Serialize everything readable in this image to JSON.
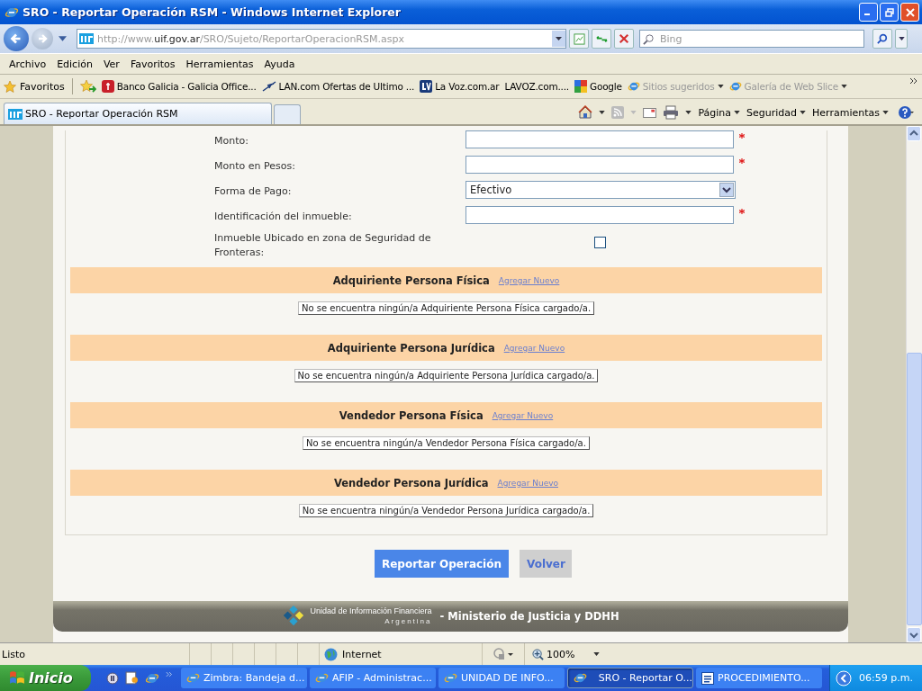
{
  "window": {
    "title": "SRO - Reportar Operación RSM - Windows Internet Explorer"
  },
  "address_bar": {
    "url_prefix": "http://www.",
    "url_domain": "uif.gov.ar",
    "url_path": "/SRO/Sujeto/ReportarOperacionRSM.aspx"
  },
  "search": {
    "placeholder": "Bing"
  },
  "menu": [
    "Archivo",
    "Edición",
    "Ver",
    "Favoritos",
    "Herramientas",
    "Ayuda"
  ],
  "favorites": {
    "label": "Favoritos",
    "items": [
      {
        "kind": "galicia",
        "label": "Banco Galicia - Galicia Office...",
        "dimmed": false,
        "dropdown": false
      },
      {
        "kind": "lan",
        "label": "LAN.com Ofertas de Ultimo ...",
        "dimmed": false,
        "dropdown": false
      },
      {
        "kind": "lavoz",
        "label": "La Voz.com.ar",
        "dimmed": false,
        "dropdown": false
      },
      {
        "kind": "plain",
        "label": "LAVOZ.com....",
        "dimmed": false,
        "dropdown": false
      },
      {
        "kind": "google",
        "label": "Google",
        "dimmed": false,
        "dropdown": false
      },
      {
        "kind": "ie",
        "label": "Sitios sugeridos",
        "dimmed": true,
        "dropdown": true
      },
      {
        "kind": "ie",
        "label": "Galería de Web Slice",
        "dimmed": true,
        "dropdown": true
      }
    ]
  },
  "tab": {
    "title": "SRO - Reportar Operación RSM"
  },
  "command_bar": [
    "Página",
    "Seguridad",
    "Herramientas"
  ],
  "form": {
    "fields": [
      {
        "kind": "text",
        "label": "Monto:",
        "required": true
      },
      {
        "kind": "text",
        "label": "Monto en Pesos:",
        "required": true
      },
      {
        "kind": "select",
        "label": "Forma de Pago:",
        "value": "Efectivo",
        "required": false
      },
      {
        "kind": "text",
        "label": "Identificación del inmueble:",
        "required": true
      },
      {
        "kind": "checkbox",
        "label": "Inmueble Ubicado en zona de Seguridad de Fronteras:",
        "checked": false,
        "required": false
      }
    ],
    "sections": [
      {
        "title": "Adquiriente Persona Física",
        "link": "Agregar Nuevo",
        "empty_message": "No se encuentra ningún/a Adquiriente Persona Física cargado/a."
      },
      {
        "title": "Adquiriente Persona Jurídica",
        "link": "Agregar Nuevo",
        "empty_message": "No se encuentra ningún/a Adquiriente Persona Jurídica cargado/a."
      },
      {
        "title": "Vendedor Persona Física",
        "link": "Agregar Nuevo",
        "empty_message": "No se encuentra ningún/a Vendedor Persona Física cargado/a."
      },
      {
        "title": "Vendedor Persona Jurídica",
        "link": "Agregar Nuevo",
        "empty_message": "No se encuentra ningún/a Vendedor Persona Jurídica cargado/a."
      }
    ]
  },
  "buttons": [
    {
      "label": "Reportar Operación",
      "kind": "primary"
    },
    {
      "label": "Volver",
      "kind": "secondary"
    }
  ],
  "footer": {
    "org": "Unidad de Información Financiera",
    "country": "Argentina",
    "ministry": "- Ministerio de Justicia y DDHH"
  },
  "status_bar": {
    "text": "Listo",
    "zone": "Internet",
    "zoom": "100%"
  },
  "taskbar": {
    "start": "Inicio",
    "tasks": [
      {
        "kind": "ie",
        "label": "Zimbra: Bandeja d...",
        "selected": false
      },
      {
        "kind": "ie",
        "label": "AFIP - Administrac...",
        "selected": false
      },
      {
        "kind": "ie",
        "label": "UNIDAD DE INFO...",
        "selected": false
      },
      {
        "kind": "ie",
        "label": "SRO - Reportar O...",
        "selected": true
      },
      {
        "kind": "word",
        "label": "PROCEDIMIENTO...",
        "selected": false
      }
    ],
    "clock": "06:59 p.m."
  }
}
